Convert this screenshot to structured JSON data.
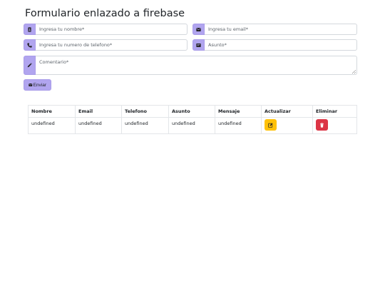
{
  "page": {
    "title": "Formulario enlazado a firebase"
  },
  "form": {
    "name_placeholder": "Ingresa tu nombre*",
    "email_placeholder": "Ingresa tu email*",
    "phone_placeholder": "Ingresa tu numero de telefono*",
    "subject_placeholder": "Asunto*",
    "comment_placeholder": "Comentario*",
    "submit_label": "Enviar"
  },
  "table": {
    "headers": [
      "Nombre",
      "Email",
      "Telefono",
      "Asunto",
      "Mensaje",
      "Actualizar",
      "Eliminar"
    ],
    "rows": [
      [
        "undefined",
        "undefined",
        "undefined",
        "undefined",
        "undefined"
      ]
    ]
  },
  "icons": {
    "name": "id-card-icon",
    "email": "envelope-icon",
    "phone": "phone-icon",
    "subject": "message-icon",
    "comment": "pencil-icon",
    "submit": "envelope-icon",
    "edit": "edit-icon",
    "delete": "trash-icon"
  },
  "colors": {
    "accent": "#b1a5ef",
    "edit": "#ffc107",
    "delete": "#dc3545"
  }
}
